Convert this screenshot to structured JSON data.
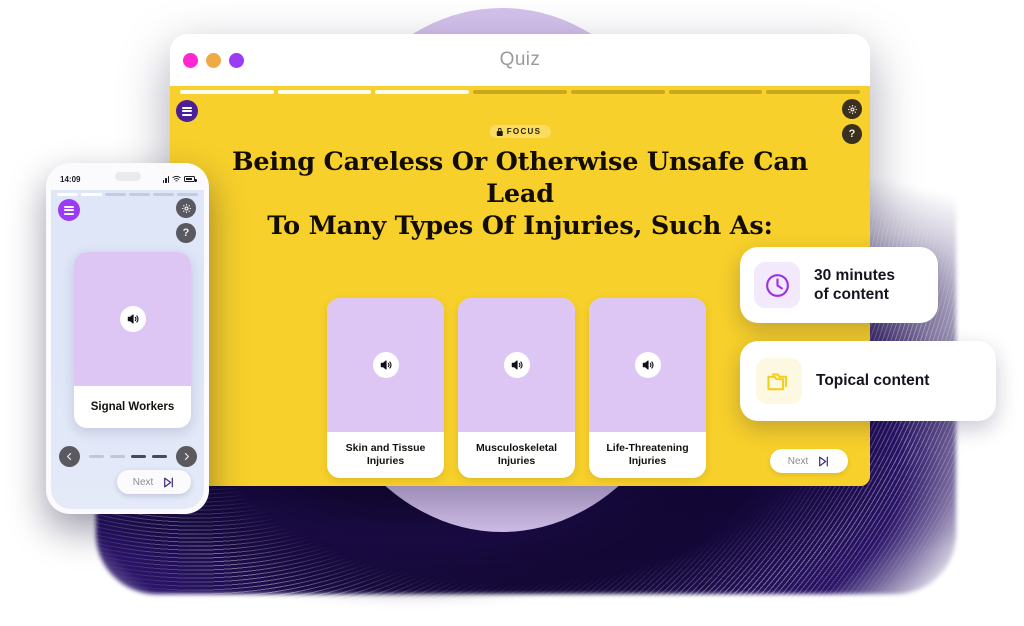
{
  "window": {
    "title": "Quiz",
    "traffic_lights": [
      {
        "name": "close",
        "color": "#ff28d0"
      },
      {
        "name": "minimize",
        "color": "#eeab45"
      },
      {
        "name": "maximize",
        "color": "#9a3cf5"
      }
    ],
    "progress": {
      "total_segments": 7,
      "completed_segments": 3
    }
  },
  "desktop": {
    "menu_icon": "hamburger-icon",
    "gear_icon": "gear-icon",
    "help_icon": "help-icon",
    "focus_badge": {
      "label": "FOCUS",
      "icon": "lock-icon"
    },
    "headline_line1": "Being Careless Or Otherwise Unsafe Can Lead",
    "headline_line2": "To Many Types Of Injuries, Such As:",
    "cards": [
      {
        "label": "Skin and Tissue Injuries",
        "icon": "speaker-icon"
      },
      {
        "label": "Musculoskeletal Injuries",
        "icon": "speaker-icon"
      },
      {
        "label": "Life-Threatening Injuries",
        "icon": "speaker-icon"
      }
    ],
    "next_label": "Next",
    "next_icon": "skip-forward-icon",
    "background_color": "#f7d02b"
  },
  "callouts": [
    {
      "icon": "clock-icon",
      "line1": "30 minutes",
      "line2": "of content",
      "icon_color": "#9b2ff0",
      "icon_bg": "#f3e9fd"
    },
    {
      "icon": "folder-icon",
      "line1": "Topical content",
      "line2": "",
      "icon_color": "#f2cf1f",
      "icon_bg": "#fdf8e2"
    }
  ],
  "phone": {
    "status": {
      "time": "14:09",
      "signal_icon": "signal-bars-icon",
      "wifi_icon": "wifi-icon",
      "battery_icon": "battery-icon"
    },
    "progress": {
      "total_segments": 6,
      "completed_segments": 2
    },
    "menu_icon": "hamburger-icon",
    "gear_icon": "gear-icon",
    "help_icon": "help-icon",
    "card": {
      "label": "Signal Workers",
      "icon": "speaker-icon"
    },
    "pager": {
      "prev_icon": "chevron-left-icon",
      "next_icon": "chevron-right-icon",
      "dots_total": 4,
      "dots_active": [
        3,
        4
      ]
    },
    "next_label": "Next",
    "next_icon": "skip-forward-icon"
  },
  "theme": {
    "yellow": "#f7d02b",
    "lavender": "#d4c2ec",
    "card_media": "#ddc6f4",
    "navy": "#1b0c45"
  }
}
